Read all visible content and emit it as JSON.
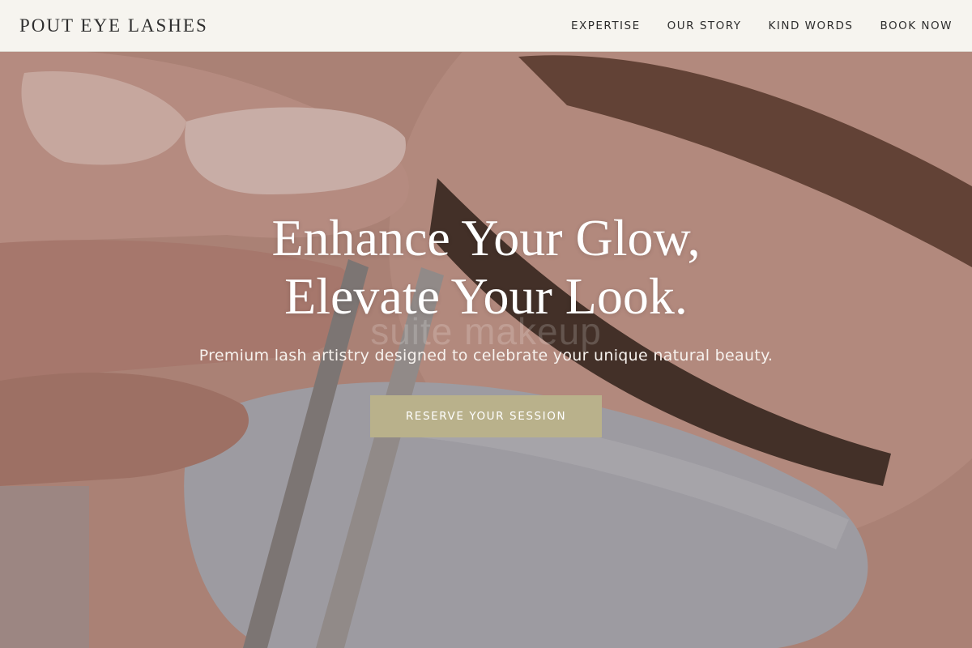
{
  "header": {
    "logo": "POUT EYE LASHES",
    "nav": [
      {
        "label": "EXPERTISE"
      },
      {
        "label": "OUR STORY"
      },
      {
        "label": "KIND WORDS"
      },
      {
        "label": "BOOK NOW"
      }
    ]
  },
  "hero": {
    "headline_line1": "Enhance Your Glow,",
    "headline_line2": "Elevate Your Look.",
    "watermark": "suite makeup",
    "tagline": "Premium lash artistry designed to celebrate your unique natural beauty.",
    "cta_label": "RESERVE YOUR SESSION"
  },
  "colors": {
    "header_bg": "#f6f4ef",
    "cta_bg": "#b9b18b",
    "text_dark": "#2f2f2f",
    "text_light": "#ffffff"
  }
}
